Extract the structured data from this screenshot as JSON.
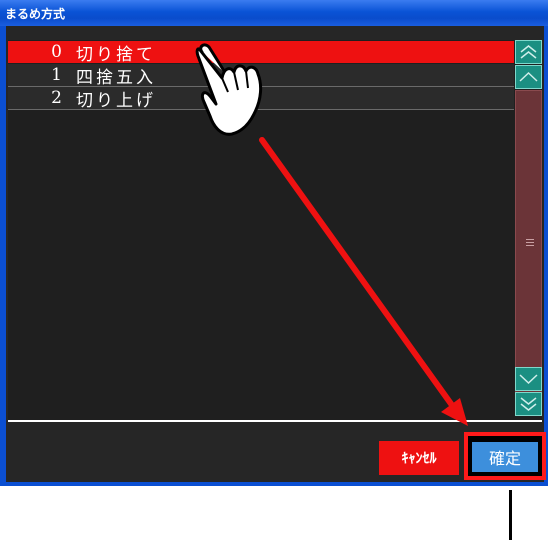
{
  "window": {
    "title": "まるめ方式"
  },
  "list": {
    "items": [
      {
        "number": "0",
        "label": "切り捨て",
        "selected": true
      },
      {
        "number": "1",
        "label": "四捨五入",
        "selected": false
      },
      {
        "number": "2",
        "label": "切り上げ",
        "selected": false
      }
    ]
  },
  "buttons": {
    "cancel_label": "ｷｬﾝｾﾙ",
    "ok_label": "確定"
  },
  "colors": {
    "selection": "#ee1111",
    "scrollbar": "#1b8f82",
    "ok_button": "#3d8fdc",
    "highlight_box": "#ff1a1a"
  },
  "annotation": {
    "pointer": "hand-pointer-icon",
    "arrow": "red-arrow-to-ok-button"
  }
}
